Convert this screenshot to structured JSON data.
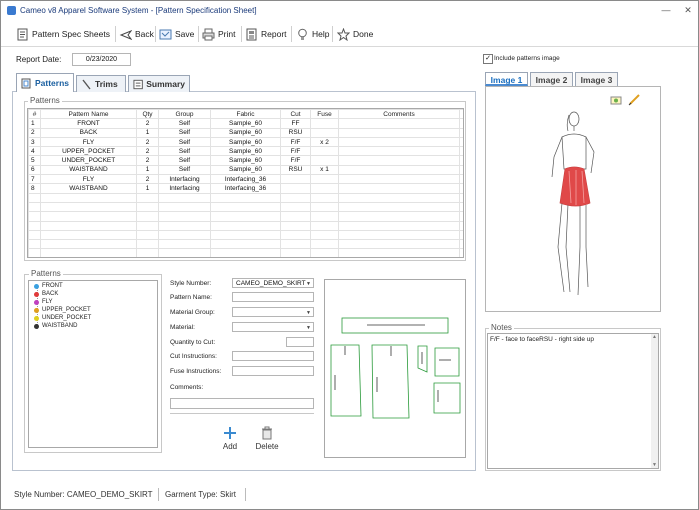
{
  "window": {
    "title": "Cameo v8 Apparel Software System - [Pattern Specification Sheet]",
    "minimize_glyph": "—",
    "close_glyph": "✕"
  },
  "toolbar": {
    "items": [
      {
        "label": "Pattern Spec Sheets",
        "icon": "document-icon"
      },
      {
        "label": "Back",
        "icon": "back-arrow-icon"
      },
      {
        "label": "Save",
        "icon": "save-icon"
      },
      {
        "label": "Print",
        "icon": "printer-icon"
      },
      {
        "label": "Report",
        "icon": "report-icon"
      },
      {
        "label": "Help",
        "icon": "lightbulb-icon"
      },
      {
        "label": "Done",
        "icon": "star-icon"
      }
    ]
  },
  "report_date": {
    "label": "Report Date:",
    "value": "0/23/2020"
  },
  "include_image": {
    "label": "Include patterns image",
    "checked": true
  },
  "tabs": [
    {
      "label": "Patterns",
      "active": true
    },
    {
      "label": "Trims",
      "active": false
    },
    {
      "label": "Summary",
      "active": false
    }
  ],
  "patterns_group": {
    "title": "Patterns",
    "columns": [
      "#",
      "Pattern Name",
      "Qty",
      "Group",
      "Fabric",
      "Cut",
      "Fuse",
      "Comments"
    ],
    "rows": [
      [
        "1",
        "FRONT",
        "2",
        "Self",
        "Sample_60",
        "FF",
        "",
        ""
      ],
      [
        "2",
        "BACK",
        "1",
        "Self",
        "Sample_60",
        "RSU",
        "",
        ""
      ],
      [
        "3",
        "FLY",
        "2",
        "Self",
        "Sample_60",
        "F/F",
        "x 2",
        ""
      ],
      [
        "4",
        "UPPER_POCKET",
        "2",
        "Self",
        "Sample_60",
        "F/F",
        "",
        ""
      ],
      [
        "5",
        "UNDER_POCKET",
        "2",
        "Self",
        "Sample_60",
        "F/F",
        "",
        ""
      ],
      [
        "6",
        "WAISTBAND",
        "1",
        "Self",
        "Sample_60",
        "RSU",
        "x 1",
        ""
      ],
      [
        "7",
        "FLY",
        "2",
        "Interfacing",
        "Interfacing_36",
        "",
        "",
        ""
      ],
      [
        "8",
        "WAISTBAND",
        "1",
        "Interfacing",
        "Interfacing_36",
        "",
        "",
        ""
      ]
    ],
    "empty_rows": 7
  },
  "pattern_tree": {
    "title": "Patterns",
    "items": [
      {
        "label": "FRONT",
        "color": "#3aa0e0"
      },
      {
        "label": "BACK",
        "color": "#e03a3a"
      },
      {
        "label": "FLY",
        "color": "#c040c0"
      },
      {
        "label": "UPPER_POCKET",
        "color": "#e0a020"
      },
      {
        "label": "UNDER_POCKET",
        "color": "#e0d020"
      },
      {
        "label": "WAISTBAND",
        "color": "#333333"
      }
    ]
  },
  "form": {
    "style_number": {
      "label": "Style Number:",
      "value": "CAMEO_DEMO_SKIRT"
    },
    "pattern_name": {
      "label": "Pattern Name:",
      "value": ""
    },
    "material_group": {
      "label": "Material Group:",
      "value": ""
    },
    "material": {
      "label": "Material:",
      "value": ""
    },
    "quantity": {
      "label": "Quantity to Cut:",
      "value": ""
    },
    "cut_instructions": {
      "label": "Cut Instructions:",
      "value": ""
    },
    "fuse_instructions": {
      "label": "Fuse Instructions:",
      "value": ""
    },
    "comments": {
      "label": "Comments:",
      "value": ""
    }
  },
  "actions": {
    "add_label": "Add",
    "delete_label": "Delete"
  },
  "image_tabs": [
    {
      "label": "Image 1",
      "active": true
    },
    {
      "label": "Image 2",
      "active": false
    },
    {
      "label": "Image 3",
      "active": false
    }
  ],
  "notes": {
    "title": "Notes",
    "text": "F/F - face to faceRSU - right side up"
  },
  "status_bar": {
    "style": "Style Number: CAMEO_DEMO_SKIRT",
    "garment": "Garment Type: Skirt"
  },
  "colors": {
    "accent": "#1a6fc0",
    "skirt": "#e04040",
    "pattern_outline": "#2a9a3a"
  }
}
